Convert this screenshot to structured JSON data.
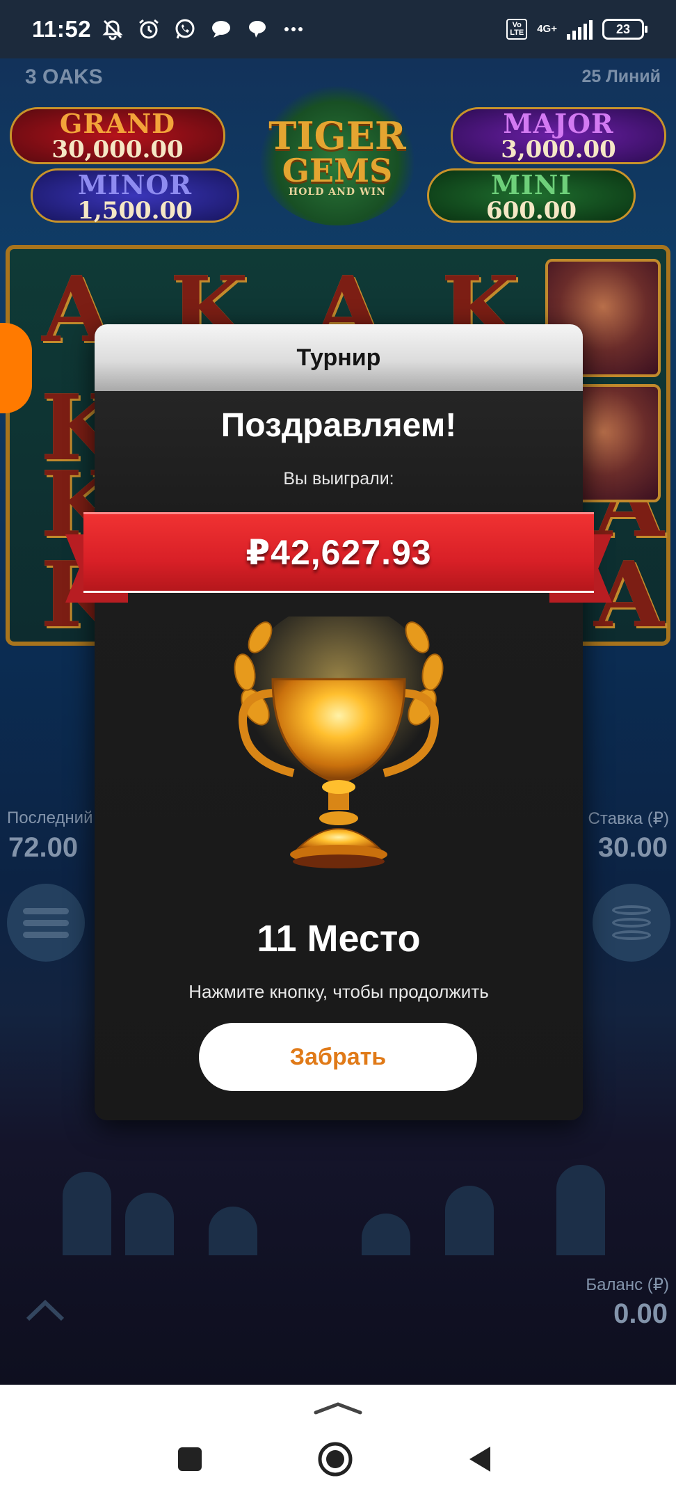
{
  "status_bar": {
    "time": "11:52",
    "icons": [
      "bell-off-icon",
      "alarm-icon",
      "whatsapp-icon",
      "message-icon",
      "chat-icon",
      "more-icon"
    ],
    "volte_label": "Vo\nLTE",
    "network_label": "4G+",
    "battery_level": "23"
  },
  "game": {
    "brand": "3 OAKS",
    "lines_label": "25 Линий",
    "title_line1": "TIGER",
    "title_line2": "GEMS",
    "title_line3": "HOLD AND WIN",
    "jackpots": {
      "grand": {
        "name": "GRAND",
        "value": "30,000.00"
      },
      "major": {
        "name": "MAJOR",
        "value": "3,000.00"
      },
      "minor": {
        "name": "MINOR",
        "value": "1,500.00"
      },
      "mini": {
        "name": "MINI",
        "value": "600.00"
      }
    },
    "reel_symbols": [
      "A",
      "K",
      "A",
      "K",
      "K",
      "K",
      "K",
      "A",
      "A"
    ],
    "last_win_label": "Последний",
    "last_win_value": "72.00",
    "bet_label": "Ставка (₽)",
    "bet_value": "30.00",
    "balance_label": "Баланс (₽)",
    "balance_value": "0.00"
  },
  "modal": {
    "header": "Турнир",
    "congrats": "Поздравляем!",
    "you_won": "Вы выиграли:",
    "prize": "₽42,627.93",
    "place": "11 Место",
    "hint": "Нажмите кнопку, чтобы продолжить",
    "claim_button": "Забрать"
  },
  "colors": {
    "ribbon_red": "#d92027",
    "claim_text": "#e07a18",
    "side_tab": "#ff7a00"
  }
}
